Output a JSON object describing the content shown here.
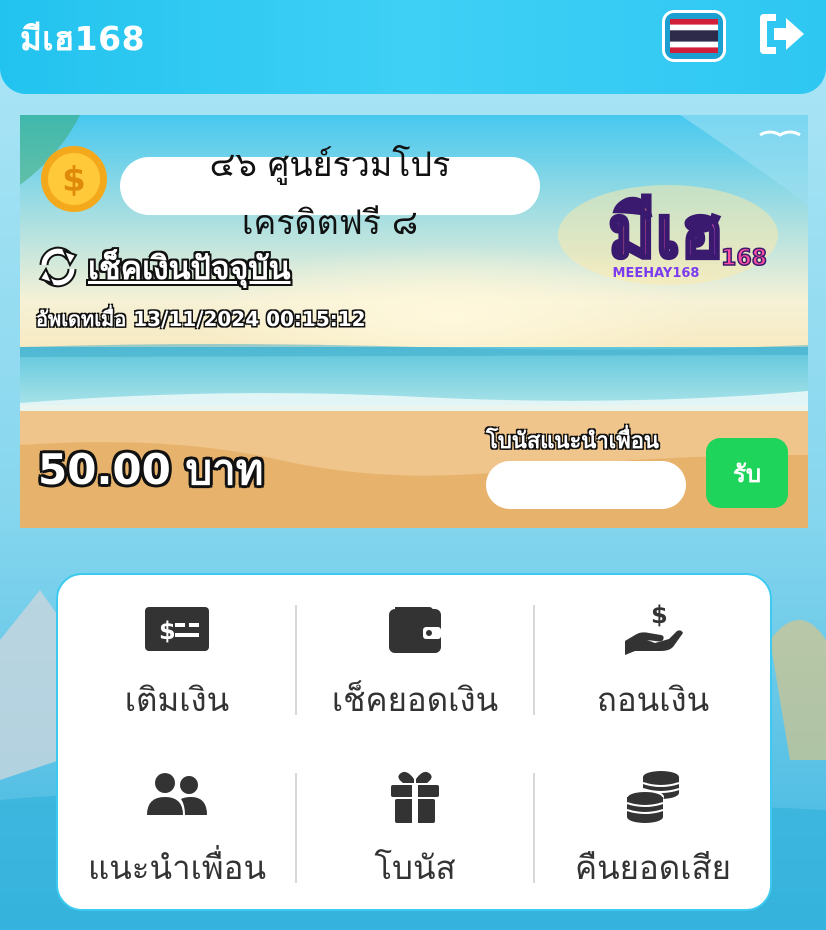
{
  "header": {
    "brand": "มีเฮ168",
    "language_flag": "thai-flag-icon",
    "logout_icon": "logout-icon"
  },
  "banner": {
    "promo_line1": "๔๖ ศูนย์รวมโปร",
    "promo_line2": "เครดิตฟรี ๘",
    "check_balance_label": "เช็คเงินปัจจุบัน",
    "updated_text": "อัพเดทเมื่อ 13/11/2024 00:15:12",
    "balance_text": "50.00 บาท",
    "referral_label": "โบนัสแนะนำเพื่อน",
    "referral_input_value": "",
    "referral_input_placeholder": "",
    "claim_button": "รับ",
    "logo_text": "MEEHAY168"
  },
  "menu": {
    "items": [
      {
        "label": "เติมเงิน",
        "icon": "cash-bill-icon"
      },
      {
        "label": "เช็คยอดเงิน",
        "icon": "wallet-icon"
      },
      {
        "label": "ถอนเงิน",
        "icon": "hand-dollar-icon"
      },
      {
        "label": "แนะนำเพื่อน",
        "icon": "users-icon"
      },
      {
        "label": "โบนัส",
        "icon": "gift-icon"
      },
      {
        "label": "คืนยอดเสีย",
        "icon": "coins-stack-icon"
      }
    ]
  },
  "colors": {
    "topbar": "#22c3ef",
    "accent_border": "#3ccaf0",
    "claim_button": "#1ed45a",
    "icon": "#333333"
  }
}
